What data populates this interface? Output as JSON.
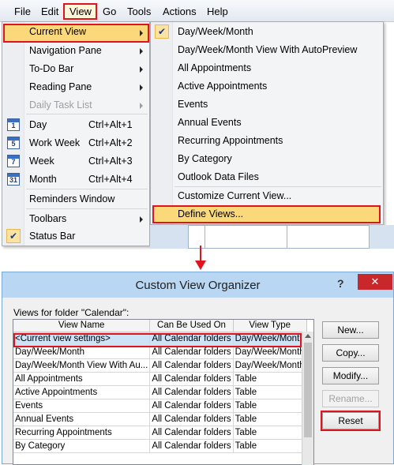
{
  "menubar": {
    "items": [
      "File",
      "Edit",
      "View",
      "Go",
      "Tools",
      "Actions",
      "Help"
    ]
  },
  "view_menu": {
    "items": [
      {
        "label": "Current View",
        "submenu": true,
        "highlighted": true
      },
      {
        "label": "Navigation Pane",
        "submenu": true
      },
      {
        "label": "To-Do Bar",
        "submenu": true
      },
      {
        "label": "Reading Pane",
        "submenu": true
      },
      {
        "label": "Daily Task List",
        "submenu": true,
        "disabled": true
      },
      {
        "label": "Day",
        "shortcut": "Ctrl+Alt+1",
        "icon": "calendar-day-icon",
        "icon_text": "1"
      },
      {
        "label": "Work Week",
        "shortcut": "Ctrl+Alt+2",
        "icon": "calendar-workweek-icon",
        "icon_text": "5"
      },
      {
        "label": "Week",
        "shortcut": "Ctrl+Alt+3",
        "icon": "calendar-week-icon",
        "icon_text": "7"
      },
      {
        "label": "Month",
        "shortcut": "Ctrl+Alt+4",
        "icon": "calendar-month-icon",
        "icon_text": "31"
      },
      {
        "label": "Reminders Window"
      },
      {
        "label": "Toolbars",
        "submenu": true
      },
      {
        "label": "Status Bar",
        "checked": true
      }
    ]
  },
  "current_view_menu": {
    "items": [
      {
        "label": "Day/Week/Month",
        "checked": true
      },
      {
        "label": "Day/Week/Month View With AutoPreview"
      },
      {
        "label": "All Appointments"
      },
      {
        "label": "Active Appointments"
      },
      {
        "label": "Events"
      },
      {
        "label": "Annual Events"
      },
      {
        "label": "Recurring Appointments"
      },
      {
        "label": "By Category"
      },
      {
        "label": "Outlook Data Files"
      },
      {
        "label": "Customize Current View..."
      },
      {
        "label": "Define Views...",
        "highlighted": true
      }
    ]
  },
  "dialog": {
    "title": "Custom View Organizer",
    "help": "?",
    "close": "✕",
    "folder_label": "Views for folder \"Calendar\":",
    "columns": [
      "View Name",
      "Can Be Used On",
      "View Type"
    ],
    "rows": [
      [
        "<Current view settings>",
        "All Calendar folders",
        "Day/Week/Month"
      ],
      [
        "Day/Week/Month",
        "All Calendar folders",
        "Day/Week/Month"
      ],
      [
        "Day/Week/Month View With Au...",
        "All Calendar folders",
        "Day/Week/Month"
      ],
      [
        "All Appointments",
        "All Calendar folders",
        "Table"
      ],
      [
        "Active Appointments",
        "All Calendar folders",
        "Table"
      ],
      [
        "Events",
        "All Calendar folders",
        "Table"
      ],
      [
        "Annual Events",
        "All Calendar folders",
        "Table"
      ],
      [
        "Recurring Appointments",
        "All Calendar folders",
        "Table"
      ],
      [
        "By Category",
        "All Calendar folders",
        "Table"
      ]
    ],
    "buttons": {
      "new": "New...",
      "copy": "Copy...",
      "modify": "Modify...",
      "rename": "Rename...",
      "reset": "Reset"
    }
  },
  "colors": {
    "highlight_border": "#e0141e",
    "menu_highlight": "#fbd97a",
    "titlebar": "#b9d6f2"
  }
}
